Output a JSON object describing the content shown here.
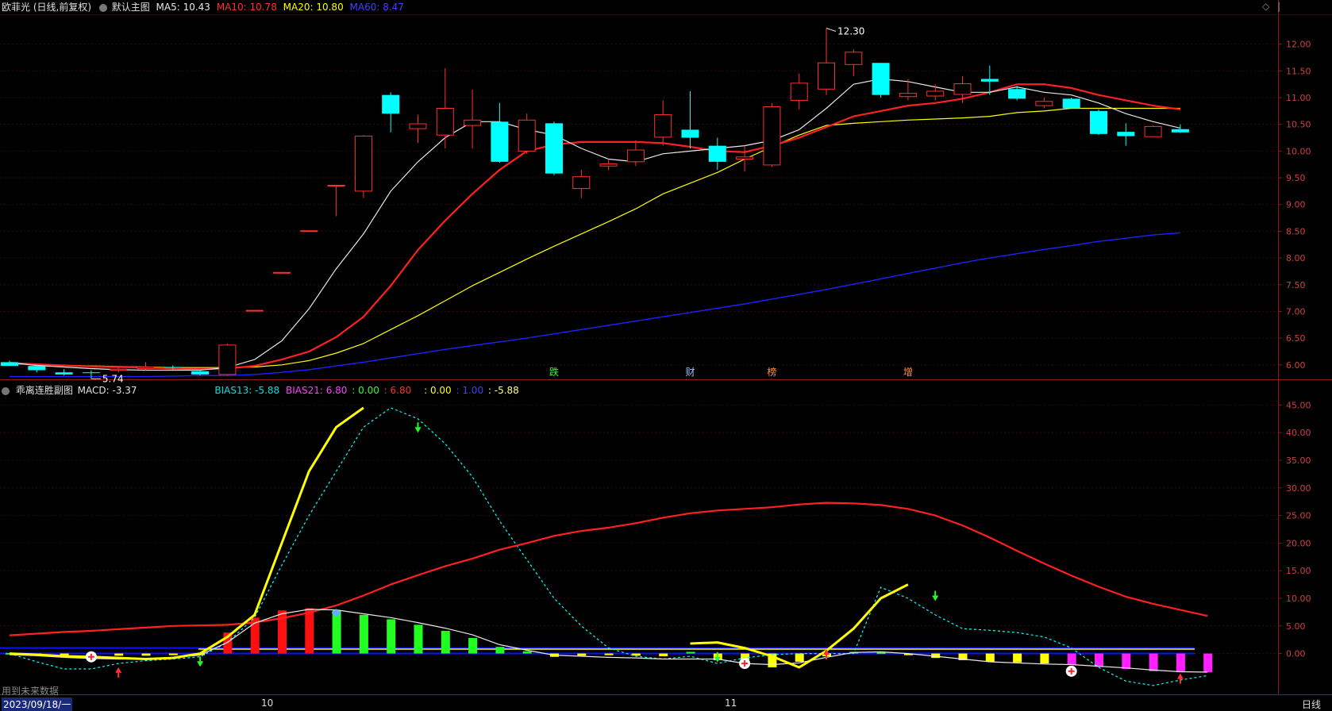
{
  "header": {
    "stock_name": "欧菲光",
    "period_desc": "(日线,前复权)",
    "template": "默认主图",
    "ma5_label": "MA5: 10.43",
    "ma10_label": "MA10: 10.78",
    "ma20_label": "MA20: 10.80",
    "ma60_label": "MA60: 8.47"
  },
  "sub_header": {
    "indicator_name": "乖离连胜副图",
    "macd_label": "MACD: -3.37",
    "bias13_label": "BIAS13: -5.88",
    "bias21_label": "BIAS21: 6.80",
    "v_green": ": 0.00",
    "v_red": ": 6.80",
    "v_yellow": ": 0.00",
    "v_blue": ": 1.00",
    "v_last": ": -5.88"
  },
  "footer": {
    "future_data_note": "用到未来数据",
    "start_date": "2023/09/18/一",
    "month_oct": "10",
    "month_nov": "11",
    "period_button": "日线"
  },
  "colors": {
    "up": "#ff3030",
    "down": "#00ffff",
    "ma5": "#e8e8e8",
    "ma10": "#ff2020",
    "ma20": "#ffff00",
    "ma60": "#2020ff",
    "axis": "#8b1a1a"
  },
  "chart_data": [
    {
      "type": "candlestick",
      "title": "欧菲光 (日线,前复权)",
      "ylim": [
        5.7,
        12.5
      ],
      "yticks": [
        "12.00",
        "11.50",
        "11.00",
        "10.50",
        "10.00",
        "9.50",
        "9.00",
        "8.50",
        "8.00",
        "7.50",
        "7.00",
        "6.50",
        "6.00"
      ],
      "candles": [
        {
          "o": 6.05,
          "h": 6.08,
          "l": 5.98,
          "c": 5.98
        },
        {
          "o": 5.98,
          "h": 6.0,
          "l": 5.86,
          "c": 5.9
        },
        {
          "o": 5.86,
          "h": 5.92,
          "l": 5.8,
          "c": 5.82
        },
        {
          "o": 5.86,
          "h": 5.9,
          "l": 5.74,
          "c": 5.85
        },
        {
          "o": 5.9,
          "h": 5.96,
          "l": 5.86,
          "c": 5.92
        },
        {
          "o": 5.93,
          "h": 6.05,
          "l": 5.9,
          "c": 5.96
        },
        {
          "o": 5.96,
          "h": 5.99,
          "l": 5.92,
          "c": 5.95
        },
        {
          "o": 5.88,
          "h": 5.9,
          "l": 5.8,
          "c": 5.82
        },
        {
          "o": 5.82,
          "h": 6.4,
          "l": 5.8,
          "c": 6.37
        },
        {
          "o": 7.02,
          "h": 7.02,
          "l": 7.02,
          "c": 7.02
        },
        {
          "o": 7.73,
          "h": 7.73,
          "l": 7.73,
          "c": 7.73
        },
        {
          "o": 8.51,
          "h": 8.51,
          "l": 8.51,
          "c": 8.51
        },
        {
          "o": 9.36,
          "h": 9.36,
          "l": 8.78,
          "c": 9.36
        },
        {
          "o": 9.25,
          "h": 10.3,
          "l": 9.12,
          "c": 10.28
        },
        {
          "o": 11.05,
          "h": 11.1,
          "l": 10.35,
          "c": 10.7
        },
        {
          "o": 10.42,
          "h": 10.68,
          "l": 10.15,
          "c": 10.51
        },
        {
          "o": 10.3,
          "h": 11.55,
          "l": 10.05,
          "c": 10.8
        },
        {
          "o": 10.48,
          "h": 11.15,
          "l": 10.05,
          "c": 10.58
        },
        {
          "o": 10.55,
          "h": 10.9,
          "l": 9.78,
          "c": 9.8
        },
        {
          "o": 10.0,
          "h": 10.7,
          "l": 9.95,
          "c": 10.58
        },
        {
          "o": 10.52,
          "h": 10.55,
          "l": 9.55,
          "c": 9.58
        },
        {
          "o": 9.3,
          "h": 9.65,
          "l": 9.12,
          "c": 9.52
        },
        {
          "o": 9.72,
          "h": 9.85,
          "l": 9.64,
          "c": 9.76
        },
        {
          "o": 9.8,
          "h": 10.2,
          "l": 9.72,
          "c": 10.02
        },
        {
          "o": 10.26,
          "h": 10.95,
          "l": 10.1,
          "c": 10.68
        },
        {
          "o": 10.4,
          "h": 11.12,
          "l": 10.05,
          "c": 10.25
        },
        {
          "o": 10.1,
          "h": 10.25,
          "l": 9.65,
          "c": 9.8
        },
        {
          "o": 9.85,
          "h": 10.1,
          "l": 9.62,
          "c": 9.89
        },
        {
          "o": 9.74,
          "h": 10.9,
          "l": 9.7,
          "c": 10.83
        },
        {
          "o": 10.95,
          "h": 11.45,
          "l": 10.78,
          "c": 11.27
        },
        {
          "o": 11.16,
          "h": 12.3,
          "l": 11.05,
          "c": 11.65
        },
        {
          "o": 11.62,
          "h": 11.9,
          "l": 11.4,
          "c": 11.85
        },
        {
          "o": 11.65,
          "h": 11.65,
          "l": 11.0,
          "c": 11.05
        },
        {
          "o": 11.02,
          "h": 11.35,
          "l": 10.95,
          "c": 11.08
        },
        {
          "o": 11.03,
          "h": 11.25,
          "l": 10.95,
          "c": 11.12
        },
        {
          "o": 11.06,
          "h": 11.4,
          "l": 10.9,
          "c": 11.26
        },
        {
          "o": 11.35,
          "h": 11.6,
          "l": 11.05,
          "c": 11.3
        },
        {
          "o": 11.16,
          "h": 11.22,
          "l": 10.95,
          "c": 10.98
        },
        {
          "o": 10.85,
          "h": 11.0,
          "l": 10.8,
          "c": 10.93
        },
        {
          "o": 10.98,
          "h": 11.0,
          "l": 10.8,
          "c": 10.8
        },
        {
          "o": 10.75,
          "h": 10.78,
          "l": 10.3,
          "c": 10.32
        },
        {
          "o": 10.36,
          "h": 10.52,
          "l": 10.1,
          "c": 10.28
        },
        {
          "o": 10.27,
          "h": 10.48,
          "l": 10.27,
          "c": 10.46
        },
        {
          "o": 10.41,
          "h": 10.5,
          "l": 10.34,
          "c": 10.35
        }
      ],
      "ma5": [
        6.04,
        5.99,
        5.96,
        5.93,
        5.91,
        5.9,
        5.9,
        5.9,
        5.95,
        6.1,
        6.45,
        7.05,
        7.8,
        8.45,
        9.25,
        9.8,
        10.25,
        10.55,
        10.55,
        10.4,
        10.3,
        10.05,
        9.85,
        9.8,
        9.95,
        10.0,
        10.05,
        10.1,
        10.2,
        10.4,
        10.8,
        11.25,
        11.35,
        11.3,
        11.2,
        11.1,
        11.1,
        11.2,
        11.1,
        11.05,
        10.9,
        10.7,
        10.55,
        10.43
      ],
      "ma10": [
        6.04,
        6.01,
        5.99,
        5.97,
        5.96,
        5.95,
        5.93,
        5.92,
        5.93,
        5.98,
        6.1,
        6.25,
        6.52,
        6.9,
        7.48,
        8.15,
        8.7,
        9.2,
        9.65,
        10.0,
        10.12,
        10.17,
        10.17,
        10.17,
        10.15,
        10.08,
        10.0,
        9.98,
        10.1,
        10.25,
        10.45,
        10.65,
        10.75,
        10.85,
        10.9,
        10.98,
        11.1,
        11.25,
        11.25,
        11.18,
        11.05,
        10.95,
        10.85,
        10.78
      ],
      "ma20": [
        6.02,
        6.01,
        5.99,
        5.98,
        5.97,
        5.96,
        5.95,
        5.95,
        5.95,
        5.96,
        6.0,
        6.08,
        6.22,
        6.4,
        6.66,
        6.92,
        7.2,
        7.48,
        7.73,
        7.98,
        8.22,
        8.45,
        8.68,
        8.92,
        9.2,
        9.4,
        9.6,
        9.85,
        10.08,
        10.3,
        10.48,
        10.52,
        10.55,
        10.58,
        10.6,
        10.62,
        10.65,
        10.72,
        10.75,
        10.8,
        10.8,
        10.8,
        10.8,
        10.8
      ],
      "ma60": [
        5.78,
        5.78,
        5.78,
        5.78,
        5.78,
        5.78,
        5.79,
        5.8,
        5.8,
        5.82,
        5.86,
        5.91,
        5.98,
        6.05,
        6.13,
        6.21,
        6.29,
        6.36,
        6.43,
        6.5,
        6.58,
        6.66,
        6.74,
        6.82,
        6.9,
        6.98,
        7.06,
        7.14,
        7.23,
        7.32,
        7.41,
        7.51,
        7.61,
        7.71,
        7.81,
        7.91,
        8.0,
        8.08,
        8.16,
        8.23,
        8.31,
        8.37,
        8.43,
        8.47
      ],
      "annotations": [
        {
          "label": "12.30",
          "value": 12.3,
          "index": 30
        },
        {
          "label": "5.74",
          "value": 5.74,
          "index": 3
        }
      ],
      "signals": [
        {
          "index": 20,
          "text": "跌",
          "color": "#30ff30"
        },
        {
          "index": 25,
          "text": "财",
          "color": "#a0c0ff"
        },
        {
          "index": 28,
          "text": "榜",
          "color": "#ff9040"
        },
        {
          "index": 33,
          "text": "增",
          "color": "#ff9040"
        }
      ]
    },
    {
      "type": "line",
      "title": "乖离连胜副图",
      "ylim": [
        -3.8,
        46.5
      ],
      "yticks": [
        "45.00",
        "40.00",
        "35.00",
        "30.00",
        "25.00",
        "20.00",
        "15.00",
        "10.00",
        "5.00",
        "0.00"
      ],
      "series": [
        {
          "name": "BIAS13",
          "color": "#00ffff",
          "values": [
            0.0,
            -1.5,
            -2.8,
            -2.8,
            -1.8,
            -1.3,
            -1.0,
            -0.6,
            2.0,
            6.5,
            16.0,
            25.0,
            33.0,
            41.0,
            44.5,
            42.5,
            38.0,
            32.0,
            24.0,
            17.0,
            10.0,
            5.0,
            1.0,
            -0.5,
            -1.0,
            -0.5,
            -1.8,
            -0.8,
            -0.2,
            0.0,
            0.0,
            0.0,
            12.0,
            10.0,
            7.0,
            4.5,
            4.2,
            3.8,
            3.0,
            1.0,
            -2.5,
            -5.0,
            -5.8,
            -4.8,
            -4.0
          ]
        },
        {
          "name": "BIAS21",
          "color": "#ff2020",
          "values": [
            3.3,
            3.6,
            3.9,
            4.1,
            4.4,
            4.7,
            5.0,
            5.1,
            5.2,
            5.6,
            6.4,
            7.4,
            8.7,
            10.5,
            12.5,
            14.2,
            15.8,
            17.2,
            18.8,
            20.0,
            21.3,
            22.2,
            22.8,
            23.6,
            24.6,
            25.4,
            25.9,
            26.2,
            26.5,
            27.0,
            27.3,
            27.2,
            26.9,
            26.2,
            25.0,
            23.2,
            21.0,
            18.6,
            16.3,
            14.1,
            12.1,
            10.3,
            9.0,
            7.9,
            6.8
          ]
        },
        {
          "name": "MACD",
          "color": "#e8e8e8",
          "values": [
            -0.2,
            -0.4,
            -0.7,
            -0.9,
            -1.0,
            -1.0,
            -0.7,
            -0.3,
            2.0,
            5.5,
            7.2,
            8.0,
            7.9,
            7.2,
            6.5,
            5.6,
            4.6,
            3.4,
            1.6,
            0.6,
            -0.3,
            -0.5,
            -0.7,
            -0.8,
            -1.0,
            -1.0,
            -1.0,
            -1.8,
            -2.0,
            -1.7,
            -0.7,
            0.2,
            0.3,
            0.0,
            -0.5,
            -1.0,
            -1.5,
            -1.7,
            -1.9,
            -2.0,
            -2.3,
            -2.6,
            -3.0,
            -3.3,
            -3.37
          ]
        },
        {
          "name": "MACD2",
          "color": "#ffff00",
          "values": [
            0.0,
            -0.2,
            -0.5,
            -0.6,
            -0.8,
            -1.0,
            -0.8,
            0.0,
            3.0,
            7.0,
            20.0,
            33.0,
            41.0,
            44.5,
            null,
            null,
            null,
            null,
            null,
            null,
            null,
            null,
            null,
            null,
            null,
            1.8,
            2.0,
            1.0,
            -0.5,
            -2.5,
            0.5,
            4.5,
            10.0,
            12.5,
            null,
            null,
            null,
            null,
            null,
            null,
            null,
            null,
            null,
            null,
            null
          ]
        }
      ],
      "histogram": [
        0.1,
        -0.3,
        -0.4,
        -0.5,
        -0.4,
        -0.4,
        -0.3,
        -0.2,
        3.8,
        6.5,
        7.8,
        8.2,
        7.8,
        7.0,
        6.2,
        5.2,
        4.1,
        2.8,
        1.2,
        0.4,
        -0.6,
        -0.4,
        -0.3,
        -0.4,
        -0.5,
        0.3,
        -1.2,
        -2.0,
        -2.5,
        -1.5,
        -0.5,
        0.3,
        0.2,
        -0.3,
        -0.8,
        -1.2,
        -1.5,
        -1.6,
        -1.8,
        -2.0,
        -2.4,
        -2.8,
        -3.2,
        -3.4,
        -3.4
      ],
      "horizontal_levels": [
        {
          "value": 1.0,
          "color": "#1010ff"
        },
        {
          "value": 0.0,
          "color": "#1010ff"
        }
      ]
    }
  ]
}
